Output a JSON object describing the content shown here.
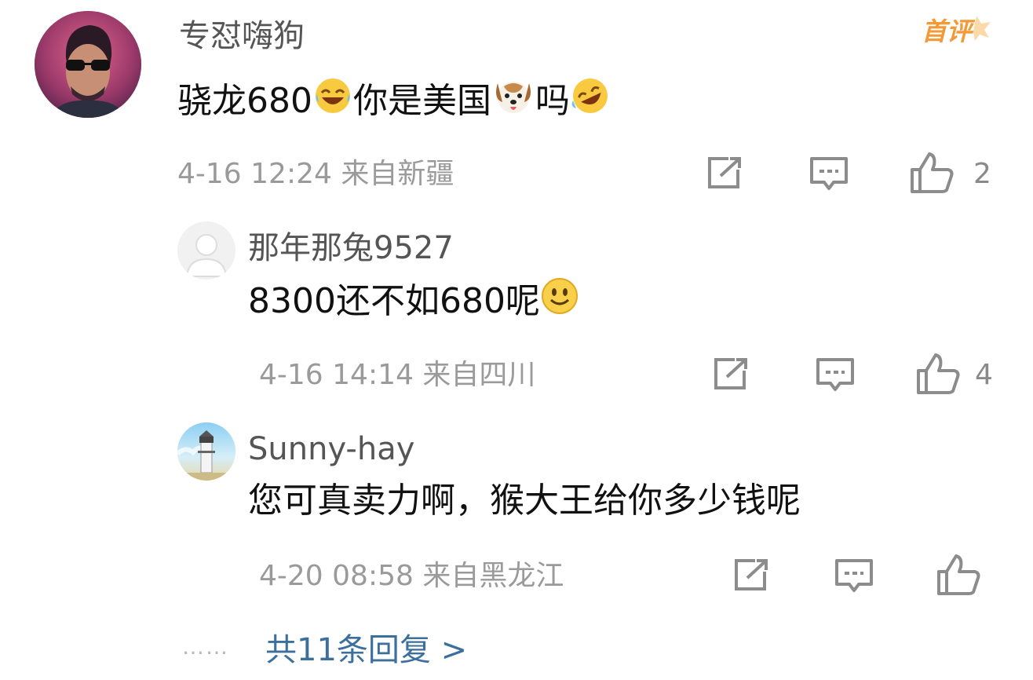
{
  "comment": {
    "username": "专怼嗨狗",
    "content_parts": [
      "骁龙680",
      "你是美国",
      "吗"
    ],
    "emojis": [
      "laughing-tears-emoji",
      "dog-face-emoji",
      "rolling-laughing-emoji"
    ],
    "badge": "首评",
    "timestamp": "4-16 12:24",
    "location": "来自新疆",
    "like_count": "2"
  },
  "replies": [
    {
      "username": "那年那兔9527",
      "content": "8300还不如680呢",
      "emoji": "smile-emoji",
      "timestamp": "4-16 14:14",
      "location": "来自四川",
      "like_count": "4"
    },
    {
      "username": "Sunny-hay",
      "content": "您可真卖力啊，猴大王给你多少钱呢",
      "timestamp": "4-20 08:58",
      "location": "来自黑龙江",
      "like_count": ""
    }
  ],
  "footer": {
    "dots": "……",
    "more_replies": "共11条回复 >"
  },
  "colors": {
    "badge": "#f39a36",
    "link": "#3d6f9c",
    "meta": "#9a9a9a"
  }
}
